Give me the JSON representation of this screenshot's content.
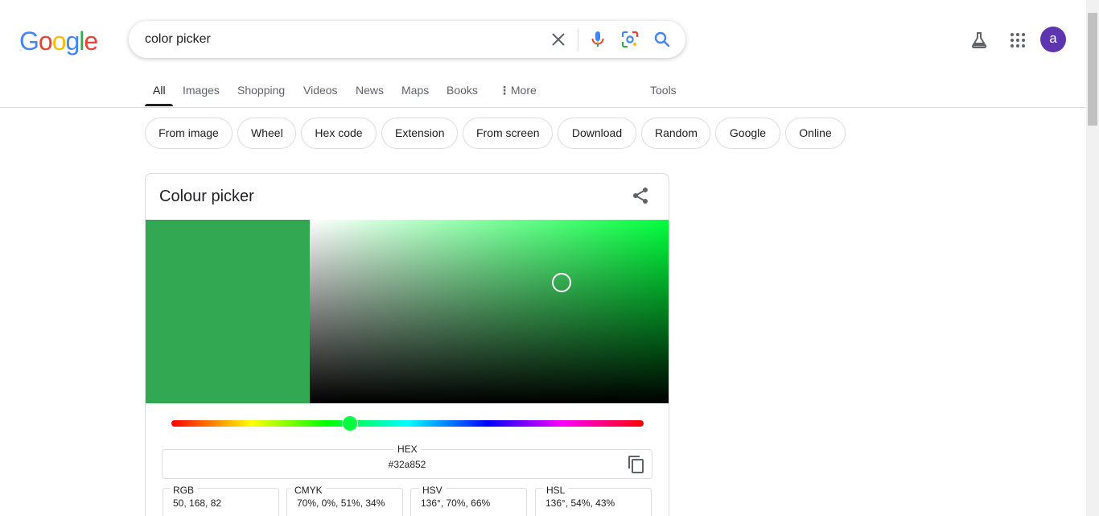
{
  "logo": {
    "text": [
      "G",
      "o",
      "o",
      "g",
      "l",
      "e"
    ],
    "colors": [
      "#4285F4",
      "#EA4335",
      "#FBBC05",
      "#4285F4",
      "#34A853",
      "#EA4335"
    ]
  },
  "search": {
    "value": "color picker",
    "placeholder": ""
  },
  "header": {
    "avatar_letter": "a"
  },
  "tabs": [
    {
      "label": "All",
      "active": true
    },
    {
      "label": "Images"
    },
    {
      "label": "Shopping"
    },
    {
      "label": "Videos"
    },
    {
      "label": "News"
    },
    {
      "label": "Maps"
    },
    {
      "label": "Books"
    },
    {
      "label": "More"
    },
    {
      "label": "Tools"
    }
  ],
  "chips": [
    "From image",
    "Wheel",
    "Hex code",
    "Extension",
    "From screen",
    "Download",
    "Random",
    "Google",
    "Online"
  ],
  "picker": {
    "title": "Colour picker",
    "current_color": "#32a852",
    "hue_color": "#00ff3c",
    "hue_level": 0.378,
    "saturation": 0.7,
    "value": 0.66,
    "fields": {
      "hex": {
        "label": "HEX",
        "value": "#32a852"
      },
      "rgb": {
        "label": "RGB",
        "value": "50, 168, 82"
      },
      "cmyk": {
        "label": "CMYK",
        "value": "70%, 0%, 51%, 34%"
      },
      "hsv": {
        "label": "HSV",
        "value": "136°, 70%, 66%"
      },
      "hsl": {
        "label": "HSL",
        "value": "136°, 54%, 43%"
      }
    }
  }
}
